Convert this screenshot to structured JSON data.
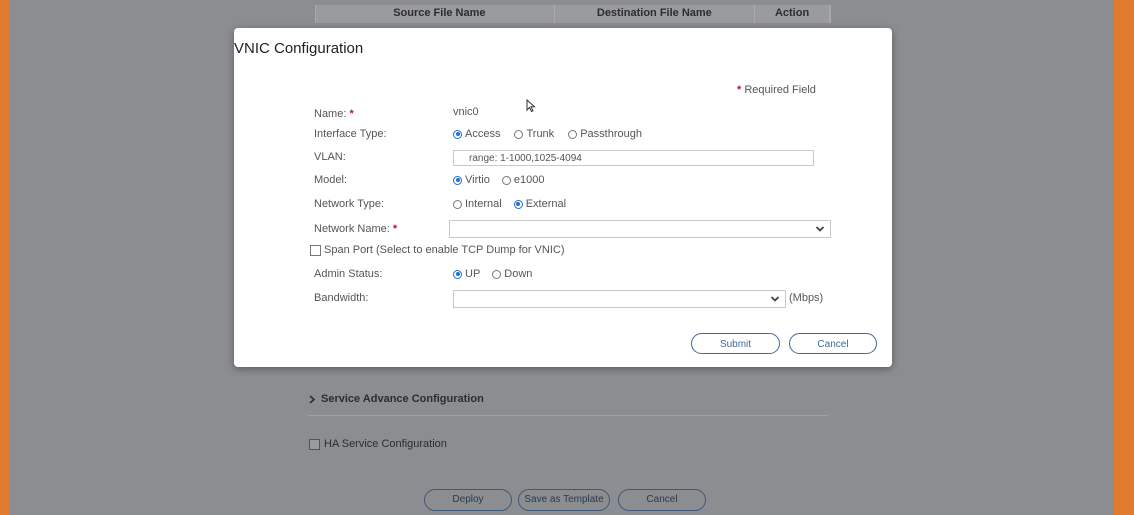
{
  "background_page": {
    "table_headers": [
      "Source File Name",
      "Destination File Name",
      "Action"
    ],
    "service_advance_link": "Service Advance Configuration",
    "ha_service_label": "HA Service Configuration",
    "buttons": {
      "deploy": "Deploy",
      "save_template": "Save as Template",
      "cancel": "Cancel"
    }
  },
  "modal": {
    "title": "VNIC Configuration",
    "required_note": "Required Field",
    "required_star": "*",
    "fields": {
      "name": {
        "label": "Name:",
        "value": "vnic0"
      },
      "interface_type": {
        "label": "Interface Type:",
        "options": [
          "Access",
          "Trunk",
          "Passthrough"
        ],
        "selected": "Access"
      },
      "vlan": {
        "label": "VLAN:",
        "value": "range: 1-1000,1025-4094"
      },
      "model": {
        "label": "Model:",
        "options": [
          "Virtio",
          "e1000"
        ],
        "selected": "Virtio"
      },
      "network_type": {
        "label": "Network Type:",
        "options": [
          "Internal",
          "External"
        ],
        "selected": "External"
      },
      "network_name": {
        "label": "Network Name:",
        "value": ""
      },
      "span_port": {
        "label": "Span Port (Select to enable TCP Dump for VNIC)",
        "checked": false
      },
      "admin_status": {
        "label": "Admin Status:",
        "options": [
          "UP",
          "Down"
        ],
        "selected": "UP"
      },
      "bandwidth": {
        "label": "Bandwidth:",
        "value": "",
        "unit": "(Mbps)"
      }
    },
    "buttons": {
      "submit": "Submit",
      "cancel": "Cancel"
    }
  },
  "colors": {
    "accent": "#1f6fd0",
    "required": "#c8102e",
    "overlay": "#8c8d90",
    "frame": "#e07a2e"
  }
}
